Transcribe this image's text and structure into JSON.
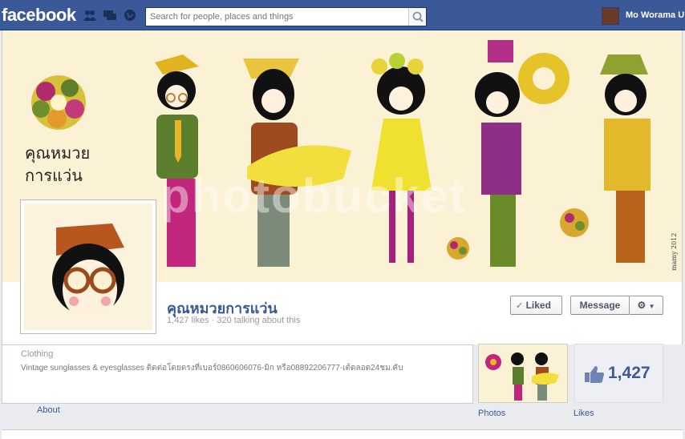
{
  "topbar": {
    "logo": "facebook",
    "search_placeholder": "Search for people, places and things",
    "user_name": "Mo Worama U"
  },
  "page": {
    "title": "คุณหมวยการแว่น",
    "stats": "1,427 likes · 320 talking about this",
    "liked_label": "Liked",
    "message_label": "Message",
    "category": "Clothing",
    "description": "Vintage sunglasses & eyesglasses ติดต่อโดยตรงที่เบอร์0860606076-มิก หรือ08892206777-เต้ดลอด24ชม.คับ",
    "about_label": "About",
    "photos_label": "Photos",
    "likes_count": "1,427",
    "likes_label": "Likes"
  },
  "cover_art": {
    "handwritten_title": "คุณหมวย การแว่น",
    "signature": "mamy 2012",
    "watermark": "photobucket"
  },
  "colors": {
    "topbar": "#3b5998",
    "cover_bg": "#fbf1d4",
    "link": "#3b5998"
  },
  "icons": [
    "friend-requests-icon",
    "messages-icon",
    "notifications-globe-icon",
    "search-icon",
    "check-icon",
    "gear-icon",
    "thumbs-up-icon"
  ]
}
